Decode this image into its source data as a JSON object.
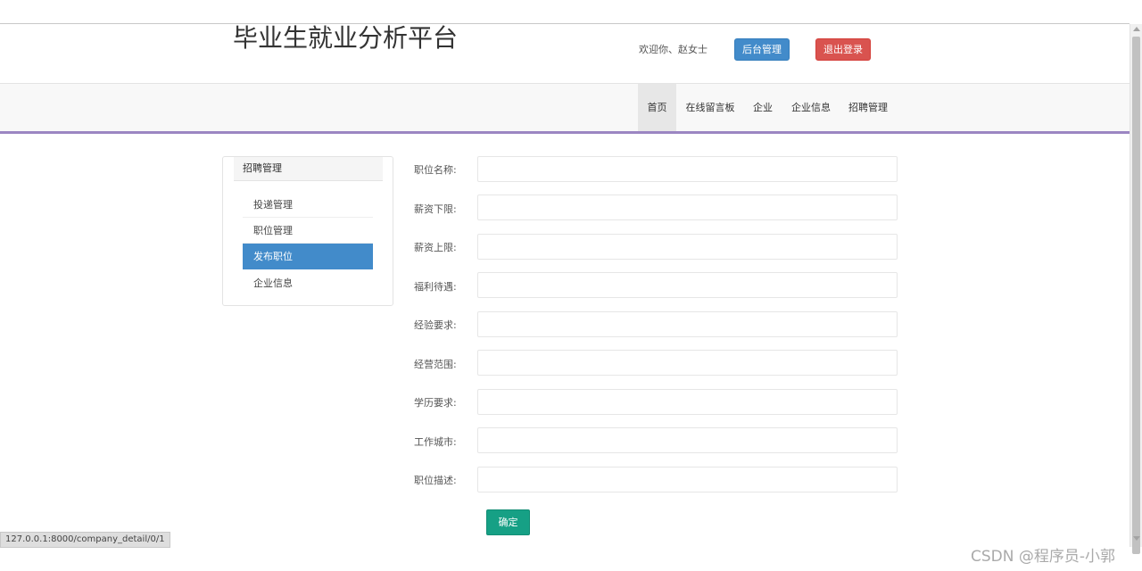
{
  "header": {
    "site_title": "毕业生就业分析平台",
    "welcome": "欢迎你、赵女士",
    "admin_label": "后台管理",
    "logout_label": "退出登录"
  },
  "nav": {
    "items": [
      {
        "label": "首页",
        "active": true
      },
      {
        "label": "在线留言板"
      },
      {
        "label": "企业"
      },
      {
        "label": "企业信息"
      },
      {
        "label": "招聘管理"
      }
    ]
  },
  "sidebar": {
    "heading": "招聘管理",
    "items": [
      {
        "label": "投递管理"
      },
      {
        "label": "职位管理"
      },
      {
        "label": "发布职位",
        "active": true
      },
      {
        "label": "企业信息"
      }
    ]
  },
  "form": {
    "fields": [
      {
        "label": "职位名称:",
        "value": ""
      },
      {
        "label": "薪资下限:",
        "value": ""
      },
      {
        "label": "薪资上限:",
        "value": ""
      },
      {
        "label": "福利待遇:",
        "value": ""
      },
      {
        "label": "经验要求:",
        "value": ""
      },
      {
        "label": "经营范围:",
        "value": ""
      },
      {
        "label": "学历要求:",
        "value": ""
      },
      {
        "label": "工作城市:",
        "value": ""
      },
      {
        "label": "职位描述:",
        "value": ""
      }
    ],
    "submit_label": "确定"
  },
  "status_bar": {
    "url": "127.0.0.1:8000/company_detail/0/1"
  },
  "watermark": "CSDN @程序员-小郭",
  "colors": {
    "primary": "#428bca",
    "danger": "#d9534f",
    "success": "#16a085",
    "nav_accent": "#9b86c2"
  }
}
